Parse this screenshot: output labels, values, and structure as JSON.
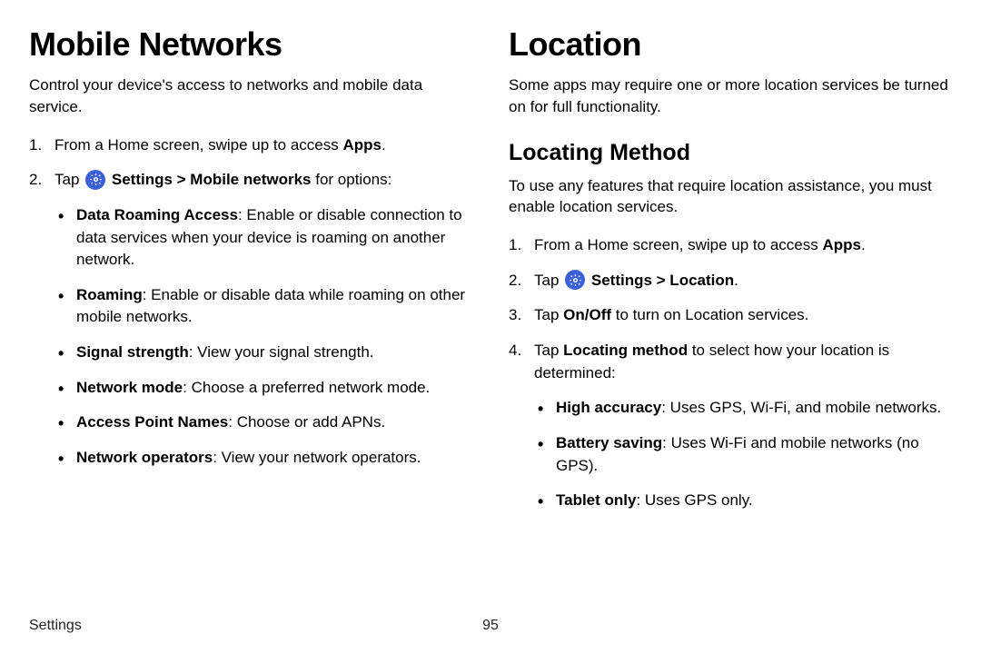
{
  "left": {
    "title": "Mobile Networks",
    "intro": "Control your device's access to networks and mobile data service.",
    "step1_pre": "From a Home screen, swipe up to access ",
    "step1_bold": "Apps",
    "step1_post": ".",
    "step2_pre": "Tap ",
    "step2_bold": "Settings > Mobile networks",
    "step2_post": " for options:",
    "bullets": [
      {
        "bold": "Data Roaming Access",
        "rest": ": Enable or disable connection to data services when your device is roaming on another network."
      },
      {
        "bold": "Roaming",
        "rest": ": Enable or disable data while roaming on other mobile networks."
      },
      {
        "bold": "Signal strength",
        "rest": ": View your signal strength."
      },
      {
        "bold": "Network mode",
        "rest": ": Choose a preferred network mode."
      },
      {
        "bold": "Access Point Names",
        "rest": ": Choose or add APNs."
      },
      {
        "bold": "Network operators",
        "rest": ": View your network operators."
      }
    ]
  },
  "right": {
    "title": "Location",
    "intro": "Some apps may require one or more location services be turned on for full functionality.",
    "subheading": "Locating Method",
    "subintro": "To use any features that require location assistance, you must enable location services.",
    "step1_pre": "From a Home screen, swipe up to access ",
    "step1_bold": "Apps",
    "step1_post": ".",
    "step2_pre": "Tap ",
    "step2_bold": "Settings > Location",
    "step2_post": ".",
    "step3_pre": "Tap ",
    "step3_bold": "On/Off",
    "step3_post": " to turn on Location services.",
    "step4_pre": "Tap ",
    "step4_bold": "Locating method",
    "step4_post": " to select how your location is determined:",
    "bullets": [
      {
        "bold": "High accuracy",
        "rest": ": Uses GPS, Wi-Fi, and mobile networks."
      },
      {
        "bold": "Battery saving",
        "rest": ": Uses Wi-Fi and mobile networks (no GPS)."
      },
      {
        "bold": "Tablet only",
        "rest": ": Uses GPS only."
      }
    ]
  },
  "footer": {
    "section": "Settings",
    "page": "95"
  }
}
